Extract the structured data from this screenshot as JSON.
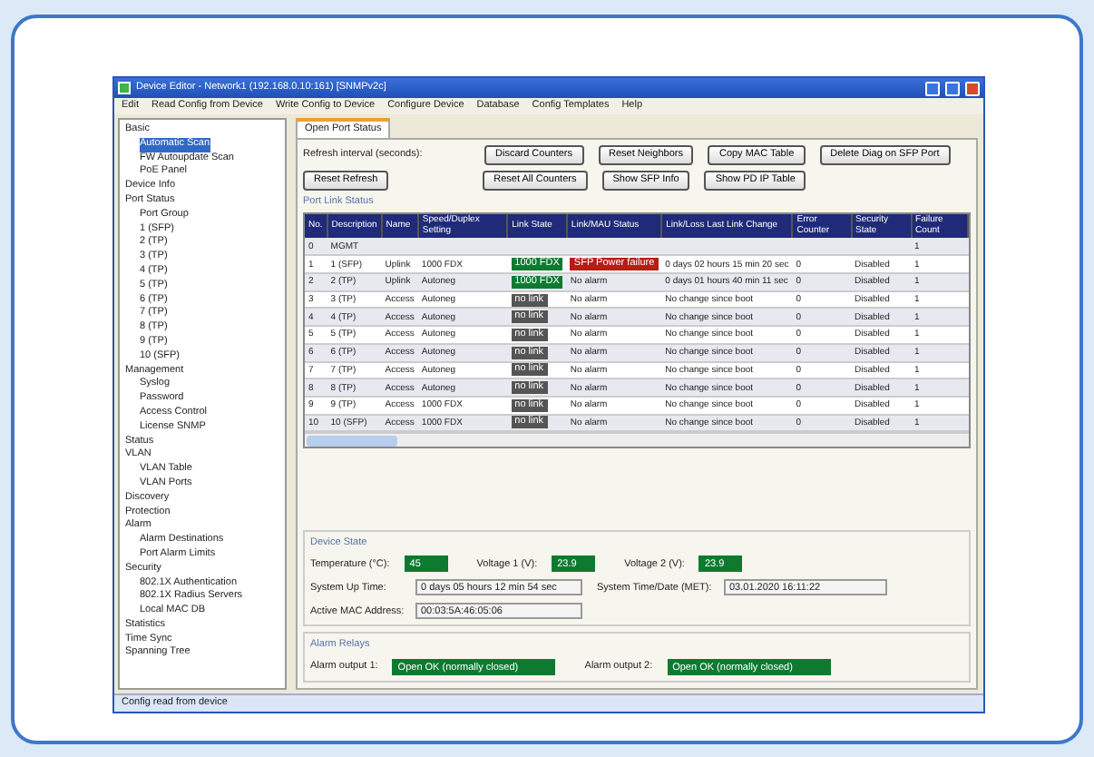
{
  "window": {
    "title": "Device Editor - Network1 (192.168.0.10:161) [SNMPv2c]"
  },
  "menu": [
    "Edit",
    "Read Config from Device",
    "Write Config to Device",
    "Configure Device",
    "Database",
    "Config Templates",
    "Help"
  ],
  "tree": [
    {
      "label": "Basic",
      "children": [
        {
          "label": "Automatic Scan",
          "selected": true
        },
        {
          "label": "FW Autoupdate Scan",
          "selected": false
        },
        {
          "label": "PoE Panel",
          "selected": false
        }
      ],
      "selected": false
    },
    {
      "label": "Device Info",
      "selected": false
    },
    {
      "label": "Port Status",
      "selected": false,
      "children": [
        {
          "label": "Port Group",
          "selected": false
        },
        {
          "label": "1 (SFP)",
          "selected": false
        },
        {
          "label": "2 (TP)",
          "selected": false
        },
        {
          "label": "3 (TP)",
          "selected": false
        },
        {
          "label": "4 (TP)",
          "selected": false
        },
        {
          "label": "5 (TP)",
          "selected": false
        },
        {
          "label": "6 (TP)",
          "selected": false
        },
        {
          "label": "7 (TP)",
          "selected": false
        },
        {
          "label": "8 (TP)",
          "selected": false
        },
        {
          "label": "9 (TP)",
          "selected": false
        },
        {
          "label": "10 (SFP)",
          "selected": false
        }
      ]
    },
    {
      "label": "Management",
      "selected": false,
      "children": [
        {
          "label": "Syslog",
          "selected": false
        },
        {
          "label": "Password",
          "selected": false
        },
        {
          "label": "Access Control",
          "selected": false
        },
        {
          "label": "License SNMP",
          "selected": false
        }
      ]
    },
    {
      "label": "Status",
      "selected": false
    },
    {
      "label": "VLAN",
      "selected": false,
      "children": [
        {
          "label": "VLAN Table",
          "selected": false
        },
        {
          "label": "VLAN Ports",
          "selected": false
        }
      ]
    },
    {
      "label": "Discovery",
      "selected": false
    },
    {
      "label": "Protection",
      "selected": false
    },
    {
      "label": "Alarm",
      "selected": false,
      "children": [
        {
          "label": "Alarm Destinations",
          "selected": false
        },
        {
          "label": "Port Alarm Limits",
          "selected": false
        }
      ]
    },
    {
      "label": "Security",
      "selected": false,
      "children": [
        {
          "label": "802.1X Authentication",
          "selected": false
        },
        {
          "label": "802.1X Radius Servers",
          "selected": false
        },
        {
          "label": "Local MAC DB",
          "selected": false
        }
      ]
    },
    {
      "label": "Statistics",
      "selected": false
    },
    {
      "label": "Time Sync",
      "selected": false
    },
    {
      "label": "Spanning Tree",
      "selected": false
    }
  ],
  "tab": {
    "label": "Open Port Status"
  },
  "refresh_label": "Refresh interval (seconds):",
  "buttons_row_1": [
    "Discard Counters",
    "Reset Neighbors",
    "Copy MAC Table",
    "Delete Diag on SFP Port"
  ],
  "manual_button": "Reset Refresh",
  "buttons_row_2": [
    "Reset All Counters",
    "Show SFP Info",
    "Show PD IP Table"
  ],
  "port_group": {
    "title": "Port Link Status",
    "columns": [
      "No.",
      "Description",
      "Name",
      "Speed/Duplex Setting",
      "Link State",
      "Link/MAU Status",
      "Link/Loss Last Link Change",
      "Error Counter",
      "Security State",
      "Failure Count"
    ],
    "rows": [
      {
        "no": "0",
        "description": "MGMT",
        "failure_count": "1"
      },
      {
        "no": "1",
        "description": "1 (SFP)",
        "name": "Uplink",
        "speed": "1000 FDX",
        "link": "1000 FDX",
        "link_up": true,
        "status": "SFP Power failure",
        "failure": true,
        "change": "0 days 02 hours 15 min 20 sec",
        "errors": "0",
        "security": "Disabled",
        "failure_count": "1"
      },
      {
        "no": "2",
        "description": "2 (TP)",
        "name": "Uplink",
        "speed": "Autoneg",
        "link": "1000 FDX",
        "link_up": true,
        "status": "No alarm",
        "failure": false,
        "change": "0 days 01 hours 40 min 11 sec",
        "errors": "0",
        "security": "Disabled",
        "failure_count": "1"
      },
      {
        "no": "3",
        "description": "3 (TP)",
        "name": "Access",
        "speed": "Autoneg",
        "link": "no link",
        "link_up": false,
        "status": "No alarm",
        "failure": false,
        "change": "No change since boot",
        "errors": "0",
        "security": "Disabled",
        "failure_count": "1"
      },
      {
        "no": "4",
        "description": "4 (TP)",
        "name": "Access",
        "speed": "Autoneg",
        "link": "no link",
        "link_up": false,
        "status": "No alarm",
        "failure": false,
        "change": "No change since boot",
        "errors": "0",
        "security": "Disabled",
        "failure_count": "1"
      },
      {
        "no": "5",
        "description": "5 (TP)",
        "name": "Access",
        "speed": "Autoneg",
        "link": "no link",
        "link_up": false,
        "status": "No alarm",
        "failure": false,
        "change": "No change since boot",
        "errors": "0",
        "security": "Disabled",
        "failure_count": "1"
      },
      {
        "no": "6",
        "description": "6 (TP)",
        "name": "Access",
        "speed": "Autoneg",
        "link": "no link",
        "link_up": false,
        "status": "No alarm",
        "failure": false,
        "change": "No change since boot",
        "errors": "0",
        "security": "Disabled",
        "failure_count": "1"
      },
      {
        "no": "7",
        "description": "7 (TP)",
        "name": "Access",
        "speed": "Autoneg",
        "link": "no link",
        "link_up": false,
        "status": "No alarm",
        "failure": false,
        "change": "No change since boot",
        "errors": "0",
        "security": "Disabled",
        "failure_count": "1"
      },
      {
        "no": "8",
        "description": "8 (TP)",
        "name": "Access",
        "speed": "Autoneg",
        "link": "no link",
        "link_up": false,
        "status": "No alarm",
        "failure": false,
        "change": "No change since boot",
        "errors": "0",
        "security": "Disabled",
        "failure_count": "1"
      },
      {
        "no": "9",
        "description": "9 (TP)",
        "name": "Access",
        "speed": "1000 FDX",
        "link": "no link",
        "link_up": false,
        "status": "No alarm",
        "failure": false,
        "change": "No change since boot",
        "errors": "0",
        "security": "Disabled",
        "failure_count": "1"
      },
      {
        "no": "10",
        "description": "10 (SFP)",
        "name": "Access",
        "speed": "1000 FDX",
        "link": "no link",
        "link_up": false,
        "status": "No alarm",
        "failure": false,
        "change": "No change since boot",
        "errors": "0",
        "security": "Disabled",
        "failure_count": "1"
      }
    ]
  },
  "device_state": {
    "title": "Device State",
    "sensors": [
      {
        "label": "Temperature (°C):",
        "value": "45",
        "ok": true
      },
      {
        "label": "Voltage 1 (V):",
        "value": "23.9",
        "ok": true
      },
      {
        "label": "Voltage 2 (V):",
        "value": "23.9",
        "ok": true
      }
    ],
    "fields": [
      {
        "label": "System Up Time:",
        "value": "0 days 05 hours 12 min 54 sec"
      },
      {
        "label": "System Time/Date (MET):",
        "value": "03.01.2020 16:11:22"
      },
      {
        "label": "Active MAC Address:",
        "value": "00:03:5A:46:05:06"
      }
    ]
  },
  "alarm_relays": {
    "title": "Alarm Relays",
    "outputs": [
      {
        "label": "Alarm output 1:",
        "value": "Open OK (normally closed)",
        "ok": true
      },
      {
        "label": "Alarm output 2:",
        "value": "Open OK (normally closed)",
        "ok": true
      }
    ]
  },
  "status_bar": "Config read from device"
}
